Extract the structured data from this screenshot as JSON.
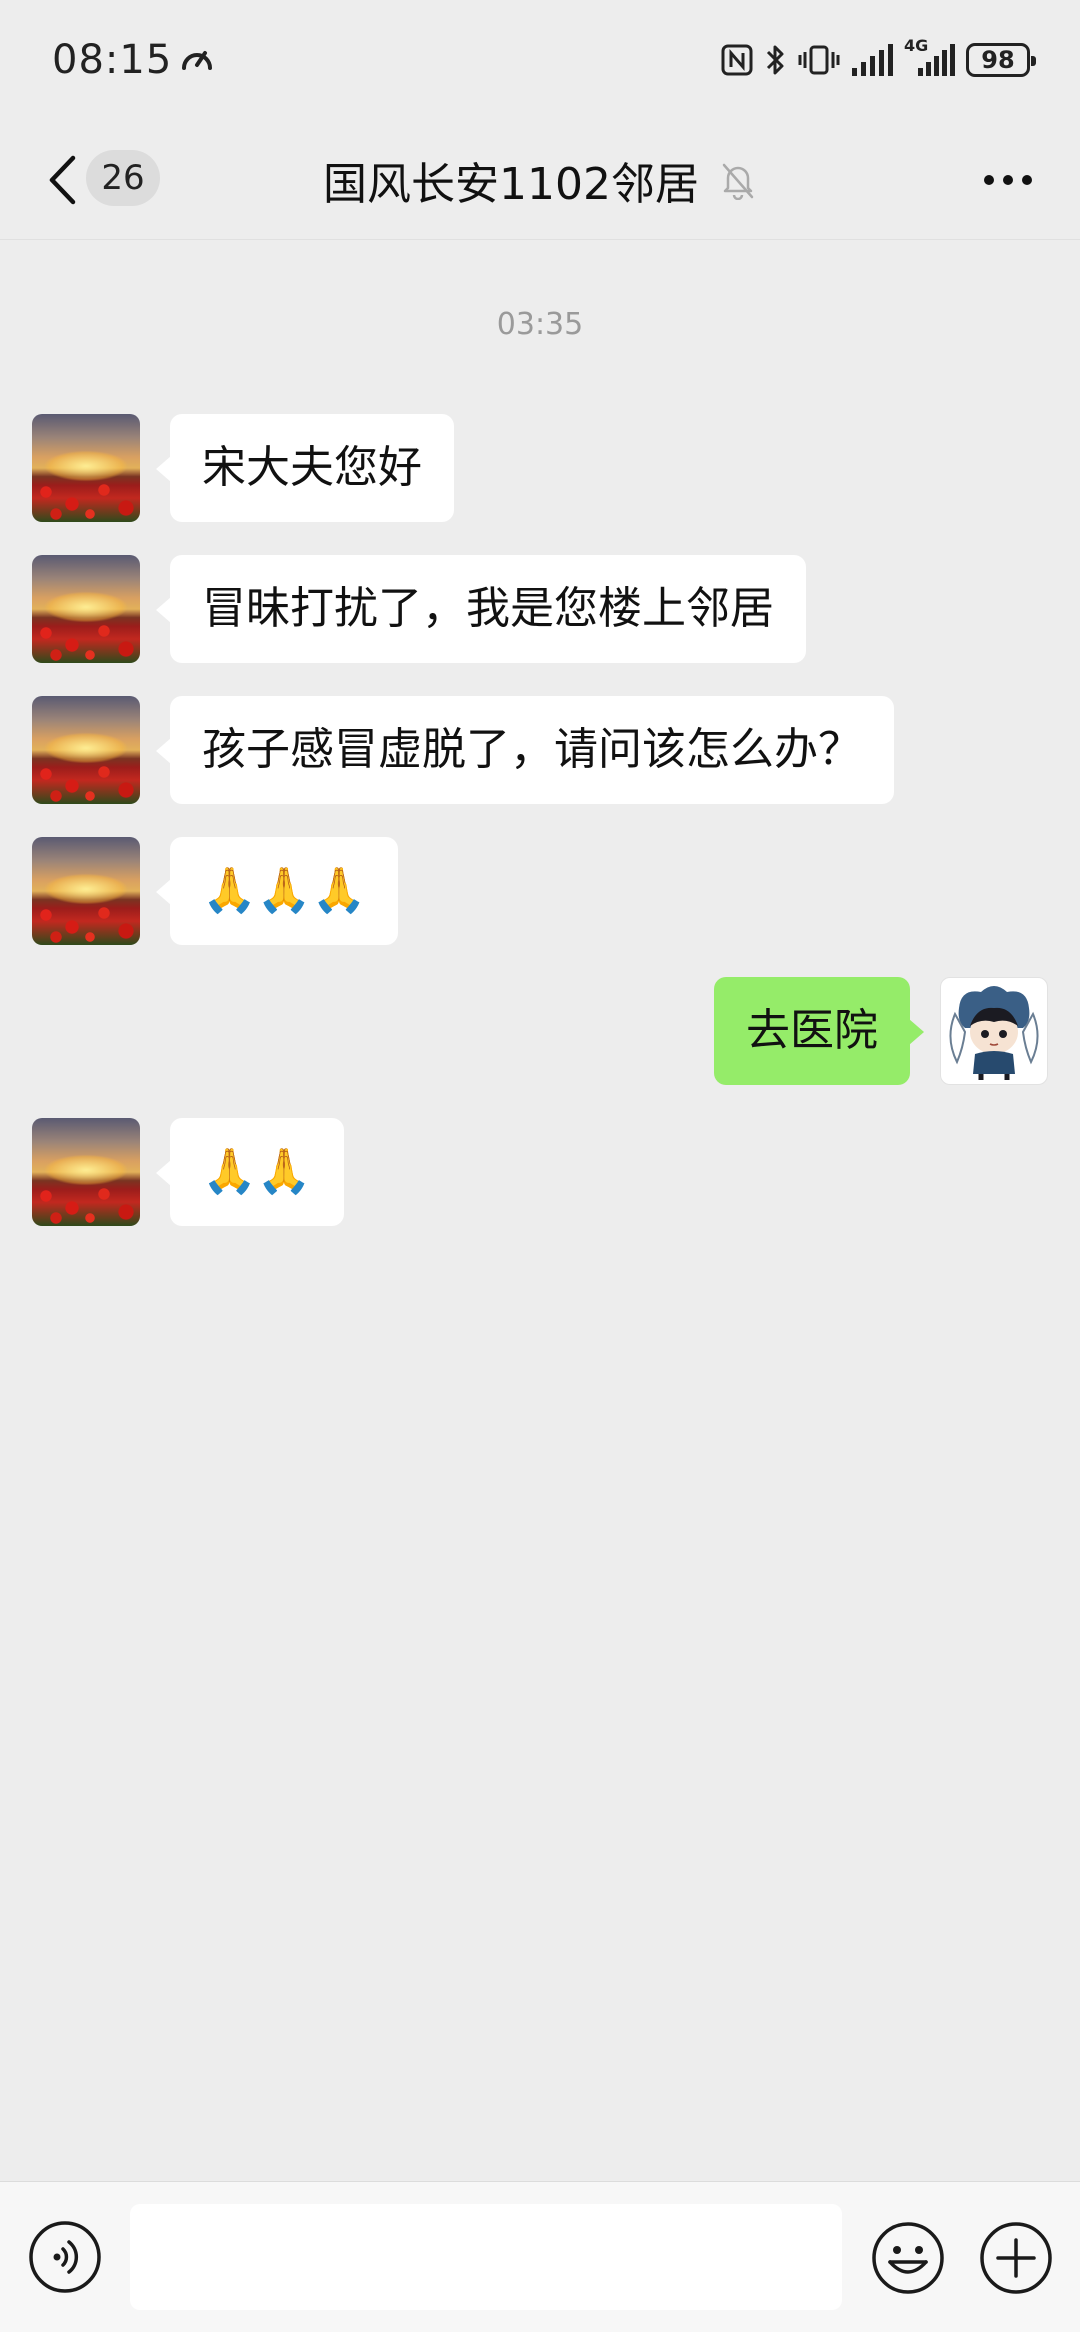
{
  "status_bar": {
    "time": "08:15",
    "network": "4G",
    "battery": "98"
  },
  "nav": {
    "unread_count": "26",
    "title": "国风长安1102邻居"
  },
  "chat": {
    "timestamp": "03:35",
    "messages": [
      {
        "side": "left",
        "text": "宋大夫您好"
      },
      {
        "side": "left",
        "text": "冒昧打扰了，我是您楼上邻居"
      },
      {
        "side": "left",
        "text": "孩子感冒虚脱了，请问该怎么办？"
      },
      {
        "side": "left",
        "emoji": "🙏🙏🙏"
      },
      {
        "side": "right",
        "text": "去医院"
      },
      {
        "side": "left",
        "emoji": "🙏🙏"
      }
    ]
  },
  "input_bar": {
    "text_value": "",
    "icons": [
      "voice-icon",
      "emoji-icon",
      "plus-icon"
    ]
  },
  "colors": {
    "background": "#EDEDED",
    "bubble_incoming": "#FFFFFF",
    "bubble_outgoing": "#95EC69"
  }
}
